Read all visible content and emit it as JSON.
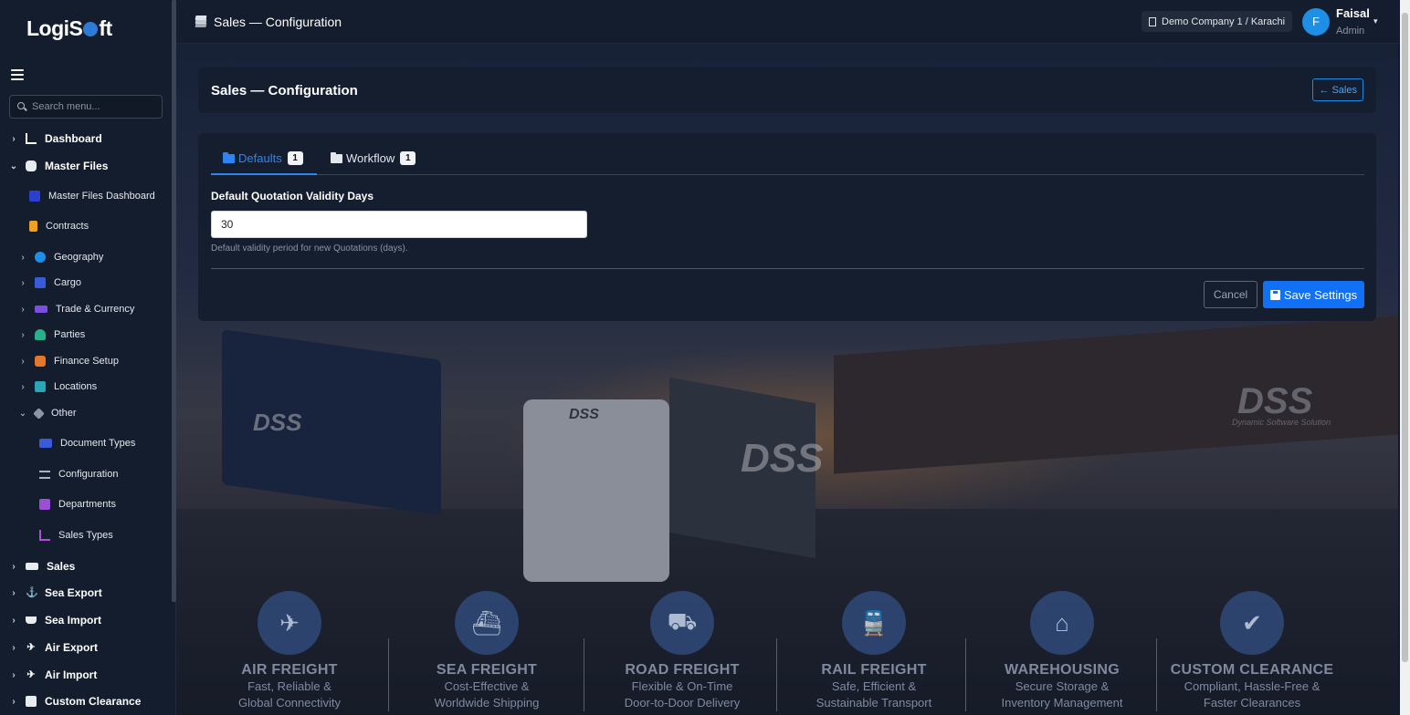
{
  "app": {
    "logo_a": "Logi",
    "logo_b": "S",
    "logo_c": "ft"
  },
  "sidebar": {
    "search_placeholder": "Search menu...",
    "items": [
      {
        "label": "Dashboard",
        "chev": "›",
        "icon": "chart-line-icon"
      },
      {
        "label": "Master Files",
        "chev": "⌄",
        "icon": "database-icon"
      },
      {
        "label": "Master Files Dashboard",
        "icon": "dashboard-icon"
      },
      {
        "label": "Contracts",
        "icon": "file-icon"
      },
      {
        "label": "Geography",
        "chev": "›",
        "icon": "globe-icon"
      },
      {
        "label": "Cargo",
        "chev": "›",
        "icon": "box-icon"
      },
      {
        "label": "Trade & Currency",
        "chev": "›",
        "icon": "handshake-icon"
      },
      {
        "label": "Parties",
        "chev": "›",
        "icon": "users-icon"
      },
      {
        "label": "Finance Setup",
        "chev": "›",
        "icon": "coins-icon"
      },
      {
        "label": "Locations",
        "chev": "›",
        "icon": "warehouse-icon"
      },
      {
        "label": "Other",
        "chev": "⌄",
        "icon": "tags-icon"
      },
      {
        "label": "Document Types",
        "icon": "id-card-icon"
      },
      {
        "label": "Configuration",
        "icon": "sliders-icon"
      },
      {
        "label": "Departments",
        "icon": "sitemap-icon"
      },
      {
        "label": "Sales Types",
        "icon": "chart-icon"
      },
      {
        "label": "Sales",
        "chev": "›",
        "icon": "handshake-icon"
      },
      {
        "label": "Sea Export",
        "chev": "›",
        "icon": "anchor-icon"
      },
      {
        "label": "Sea Import",
        "chev": "›",
        "icon": "ship-icon"
      },
      {
        "label": "Air Export",
        "chev": "›",
        "icon": "plane-icon"
      },
      {
        "label": "Air Import",
        "chev": "›",
        "icon": "plane-arrival-icon"
      },
      {
        "label": "Custom Clearance",
        "chev": "›",
        "icon": "customs-icon"
      }
    ]
  },
  "topbar": {
    "title": "Sales — Configuration",
    "company": "Demo Company 1 / Karachi",
    "user_initial": "F",
    "user_name": "Faisal",
    "user_role": "Admin",
    "caret": "▾"
  },
  "header_card": {
    "title": "Sales — Configuration",
    "back_label": "Sales",
    "back_arrow": "←"
  },
  "tabs": [
    {
      "label": "Defaults",
      "badge": "1",
      "active": true
    },
    {
      "label": "Workflow",
      "badge": "1",
      "active": false
    }
  ],
  "form": {
    "label": "Default Quotation Validity Days",
    "value": "30",
    "help": "Default validity period for new Quotations (days).",
    "cancel_label": "Cancel",
    "save_label": "Save Settings"
  },
  "background": {
    "logos": [
      "DSS",
      "DSS",
      "DSS",
      "DSS"
    ],
    "logo_tagline": "Dynamic Software Solution",
    "services": [
      {
        "title": "AIR FREIGHT",
        "line1": "Fast, Reliable &",
        "line2": "Global Connectivity",
        "icon": "plane-icon"
      },
      {
        "title": "SEA FREIGHT",
        "line1": "Cost-Effective &",
        "line2": "Worldwide Shipping",
        "icon": "ship-icon"
      },
      {
        "title": "ROAD FREIGHT",
        "line1": "Flexible & On-Time",
        "line2": "Door-to-Door Delivery",
        "icon": "truck-icon"
      },
      {
        "title": "RAIL FREIGHT",
        "line1": "Safe, Efficient &",
        "line2": "Sustainable Transport",
        "icon": "train-icon"
      },
      {
        "title": "WAREHOUSING",
        "line1": "Secure Storage &",
        "line2": "Inventory Management",
        "icon": "warehouse-icon"
      },
      {
        "title": "CUSTOM CLEARANCE",
        "line1": "Compliant, Hassle-Free &",
        "line2": "Faster Clearances",
        "icon": "clipboard-check-icon"
      }
    ]
  },
  "colors": {
    "accent": "#1170f3",
    "tab_active": "#2f84ee",
    "sidebar_bg": "#141d2e",
    "card_bg": "#151e2f"
  }
}
